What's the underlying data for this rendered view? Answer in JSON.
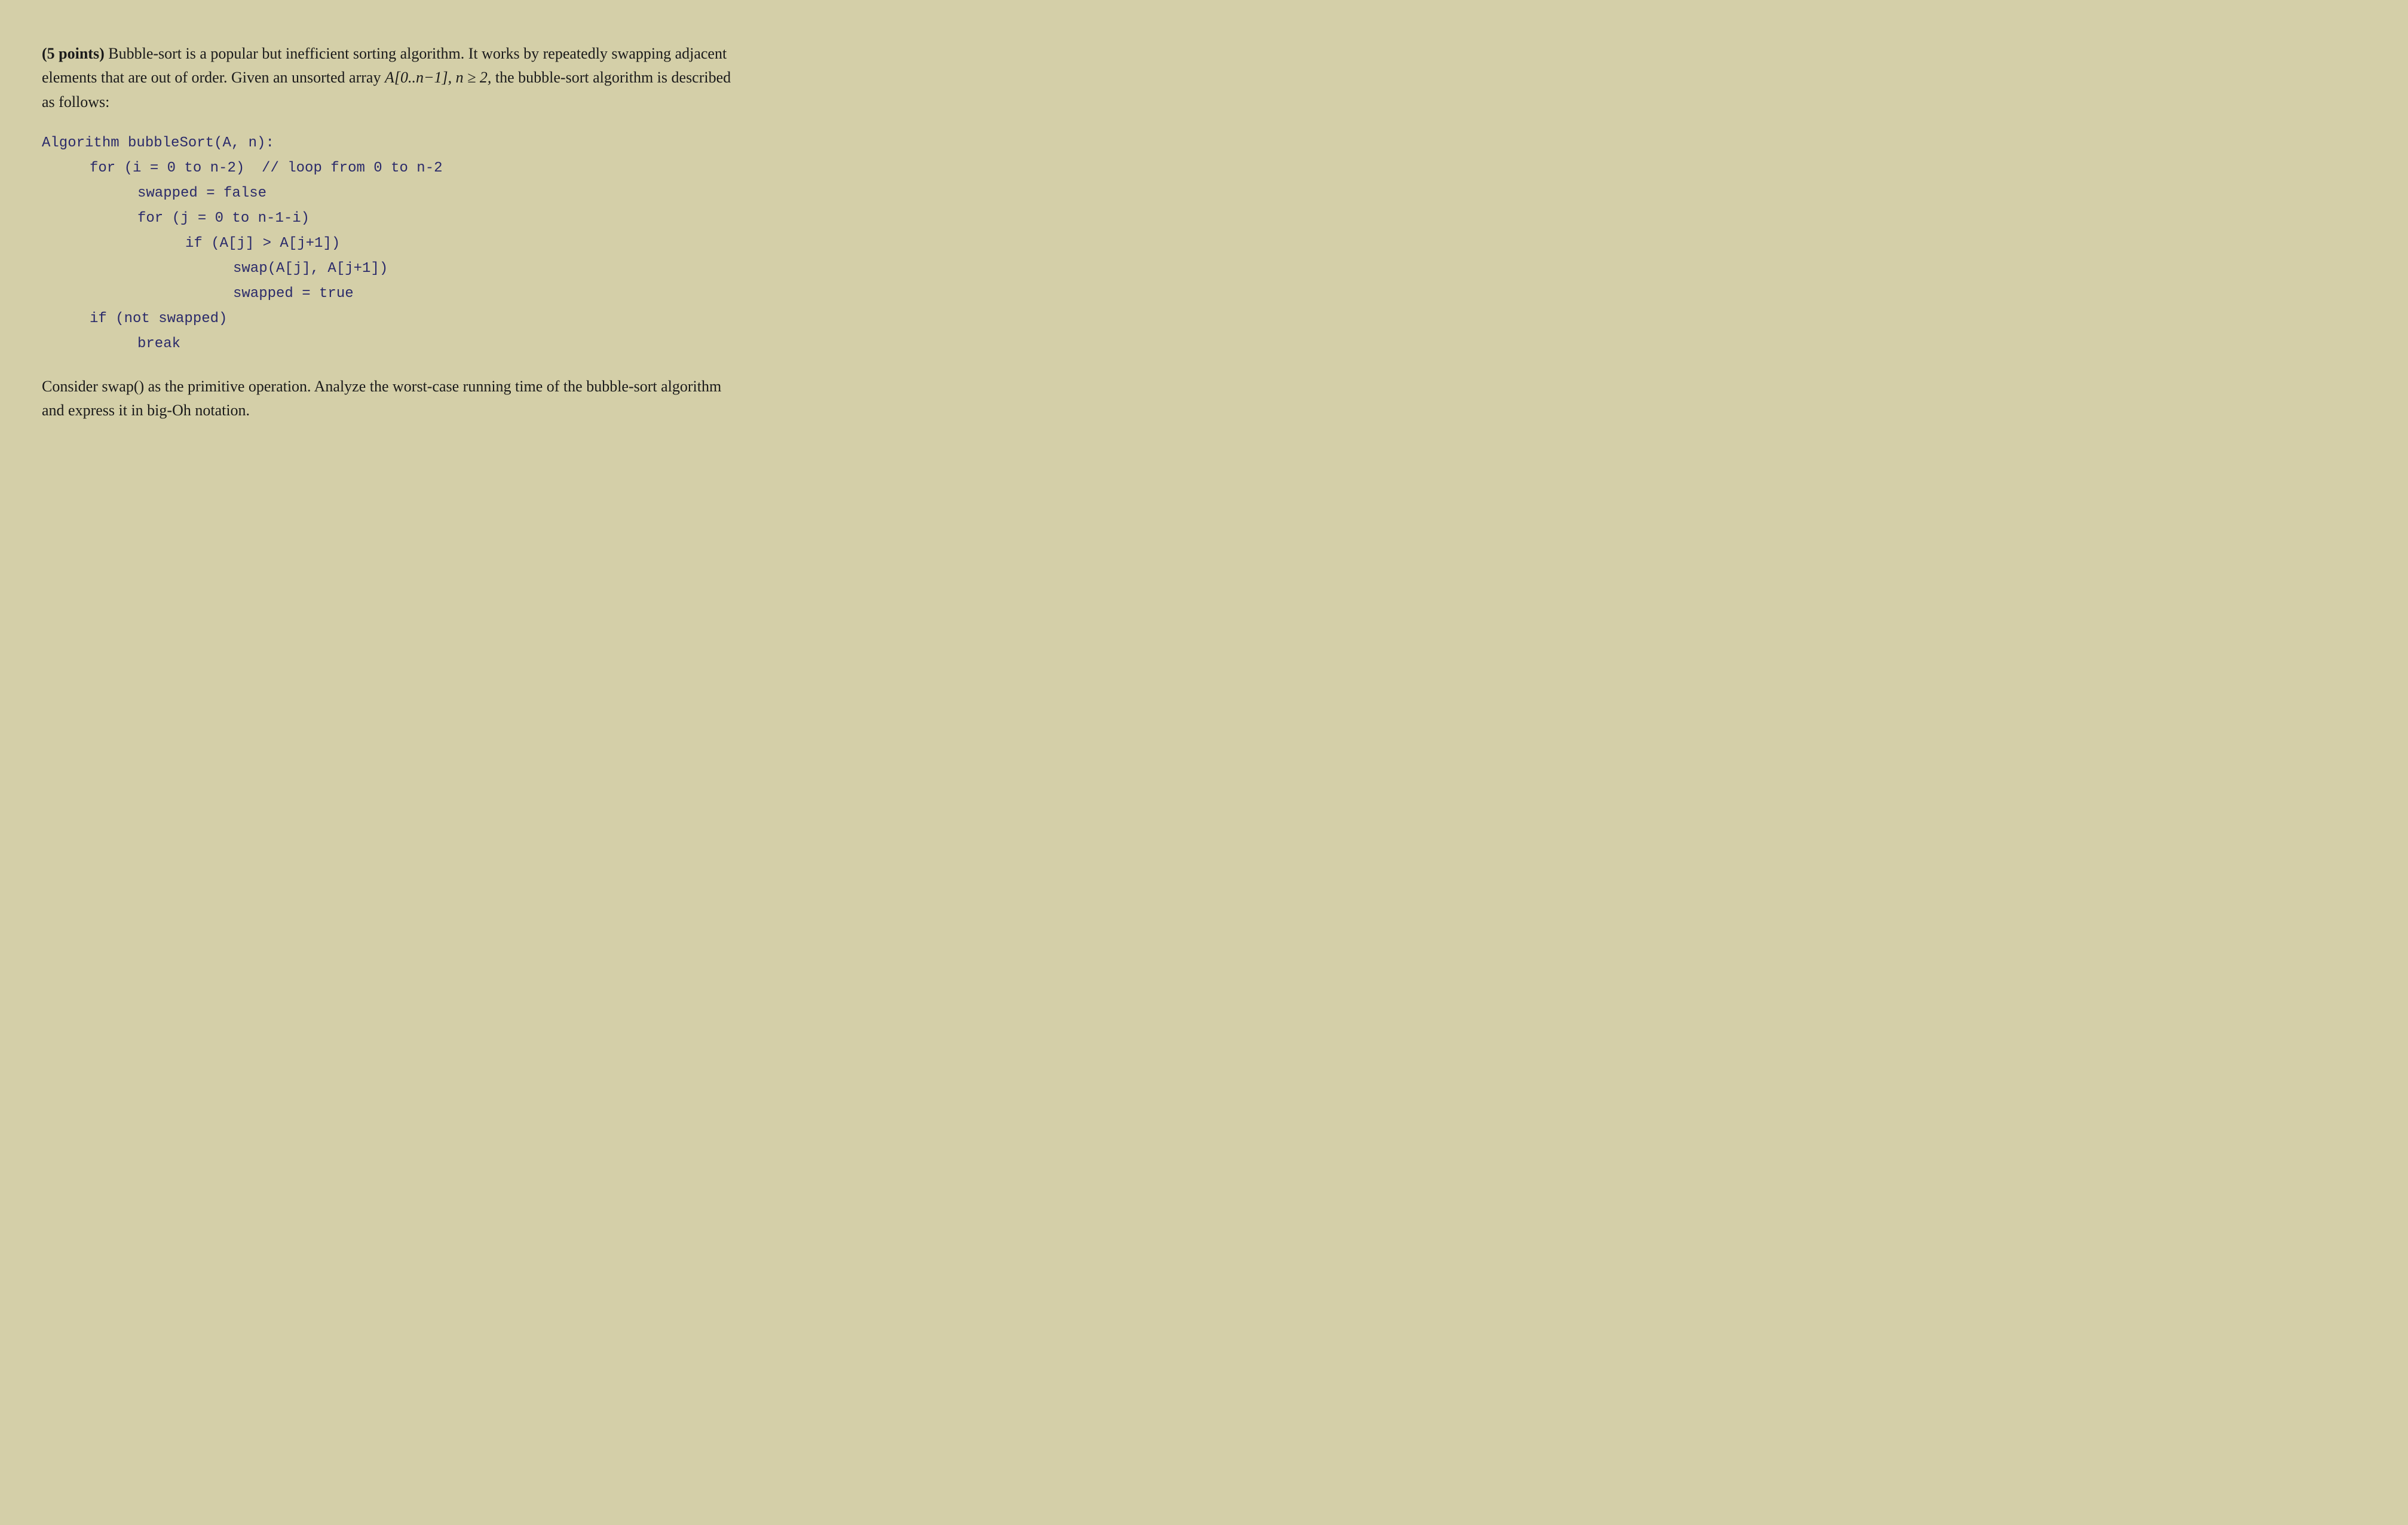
{
  "intro": {
    "points": "(5 points)",
    "text1": " Bubble-sort is a popular but inefficient sorting algorithm. It works by repeatedly swapping adjacent elements that are out of order. Given an unsorted array ",
    "array_notation": "A[0..n−1], n ≥ 2,",
    "text2": " the bubble-sort algorithm is described as follows:"
  },
  "algorithm": {
    "header": "Algorithm bubbleSort(A, n):",
    "lines": [
      {
        "indent": 1,
        "code": "for (i = 0 to n-2)  // loop from 0 to n-2"
      },
      {
        "indent": 2,
        "code": "swapped = false"
      },
      {
        "indent": 2,
        "code": "for (j = 0 to n-1-i)"
      },
      {
        "indent": 3,
        "code": "if (A[j] > A[j+1])"
      },
      {
        "indent": 4,
        "code": "swap(A[j], A[j+1])"
      },
      {
        "indent": 4,
        "code": "swapped = true"
      },
      {
        "indent": 1,
        "code": "if (not swapped)"
      },
      {
        "indent": 2,
        "code": "break"
      }
    ]
  },
  "footer": {
    "text": "Consider swap() as the primitive operation.  Analyze the worst-case running time of the bubble-sort algorithm and express it in big-Oh notation."
  }
}
